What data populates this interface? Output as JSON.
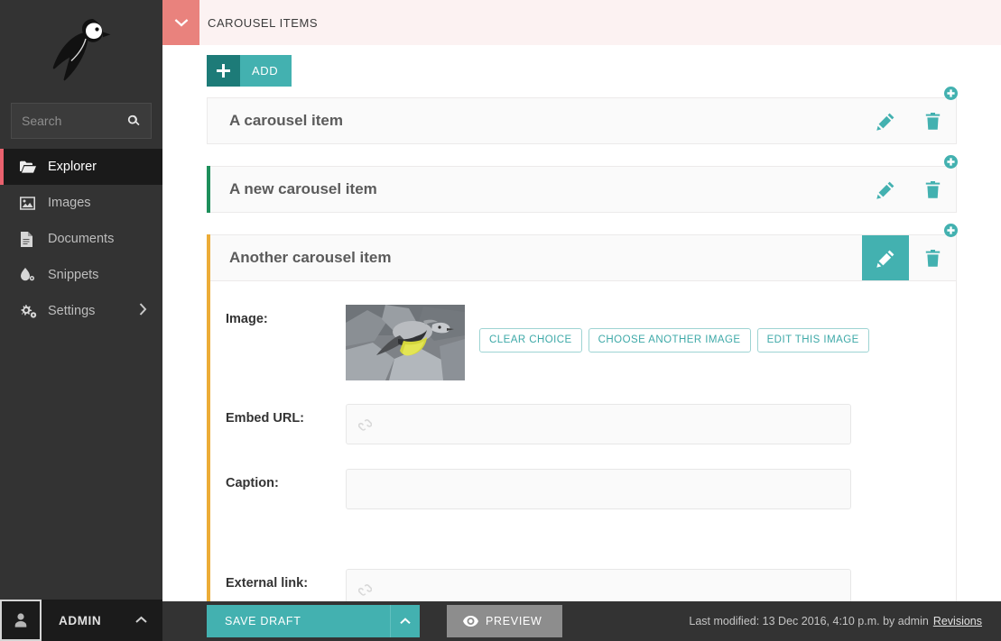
{
  "sidebar": {
    "logo_name": "wagtail-bird-logo",
    "search": {
      "placeholder": "Search",
      "value": "",
      "icon": "search-icon"
    },
    "items": [
      {
        "label": "Explorer",
        "icon": "folder-open-icon",
        "active": true
      },
      {
        "label": "Images",
        "icon": "image-icon",
        "active": false
      },
      {
        "label": "Documents",
        "icon": "document-icon",
        "active": false
      },
      {
        "label": "Snippets",
        "icon": "snippets-icon",
        "active": false
      },
      {
        "label": "Settings",
        "icon": "gears-icon",
        "active": false,
        "submenu": true
      }
    ],
    "footer": {
      "user": "ADMIN",
      "avatar_icon": "user-icon",
      "chevron": "chevron-up-icon"
    }
  },
  "panel": {
    "title": "CAROUSEL ITEMS",
    "toggle_icon": "chevron-down-icon",
    "add_button": {
      "label": "ADD",
      "icon": "plus-icon"
    },
    "add_marker_icon": "circle-plus-icon"
  },
  "items": [
    {
      "title": "A carousel item",
      "accent": "none",
      "edit_label": "edit-icon",
      "delete_label": "trash-icon",
      "expanded": false
    },
    {
      "title": "A new carousel item",
      "accent": "green",
      "edit_label": "edit-icon",
      "delete_label": "trash-icon",
      "expanded": false
    },
    {
      "title": "Another carousel item",
      "accent": "amber",
      "edit_label": "edit-icon",
      "delete_label": "trash-icon",
      "expanded": true
    }
  ],
  "form": {
    "image": {
      "label": "Image:",
      "alt": "grey-wagtail-bird-on-rocks",
      "buttons": [
        "CLEAR CHOICE",
        "CHOOSE ANOTHER IMAGE",
        "EDIT THIS IMAGE"
      ]
    },
    "embed_url": {
      "label": "Embed URL:",
      "value": "",
      "placeholder": "",
      "icon": "link-icon"
    },
    "caption": {
      "label": "Caption:",
      "value": "",
      "placeholder": ""
    },
    "external_link": {
      "label": "External link:",
      "value": "",
      "placeholder": "",
      "icon": "link-icon"
    }
  },
  "footer": {
    "save_draft": "SAVE DRAFT",
    "save_more_icon": "chevron-up-icon",
    "preview": "PREVIEW",
    "preview_icon": "eye-icon",
    "last_modified": "Last modified: 13 Dec 2016, 4:10 p.m. by admin",
    "revisions": "Revisions"
  },
  "colors": {
    "teal": "#43b1b0",
    "teal_dark": "#1d7b78",
    "salmon": "#e9827d",
    "salmon_bg": "#fcf2f2",
    "green_accent": "#1e8f5b",
    "amber_accent": "#ecac38",
    "sidebar": "#333333",
    "sidebar_active": "#1a1a1a",
    "red_accent": "#e9616e"
  }
}
